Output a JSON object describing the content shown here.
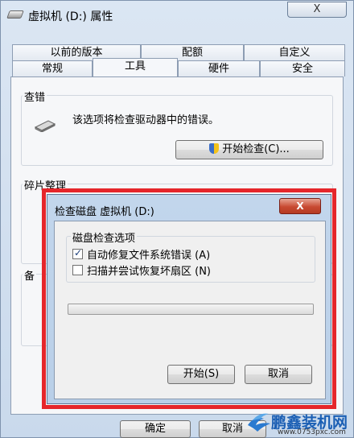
{
  "window": {
    "title": "虚拟机 (D:) 属性",
    "close_label": "X"
  },
  "tabs_back": [
    "以前的版本",
    "配额",
    "自定义"
  ],
  "tabs_front": [
    "常规",
    "工具",
    "硬件",
    "安全"
  ],
  "error_check": {
    "group_title": "查错",
    "description": "该选项将检查驱动器中的错误。",
    "button_label": "开始检查(C)..."
  },
  "defrag": {
    "group_title": "碎片整理"
  },
  "backup": {
    "group_title_partial": "备"
  },
  "buttons": {
    "ok": "确定",
    "cancel": "取消"
  },
  "dialog": {
    "title": "检查磁盘 虚拟机 (D:)",
    "close_label": "X",
    "options_title": "磁盘检查选项",
    "option1": "自动修复文件系统错误 (A)",
    "option1_checked": true,
    "option2": "扫描并尝试恢复坏扇区 (N)",
    "option2_checked": false,
    "progress": 0,
    "start_label": "开始(S)",
    "cancel_label": "取消"
  },
  "watermark": {
    "brand": "鹏鑫装机网",
    "url": "www.0753pxc.com"
  },
  "colors": {
    "highlight": "#e5262b",
    "dialog_frame": "#c2d6ec",
    "brand": "#1b5fb4"
  }
}
